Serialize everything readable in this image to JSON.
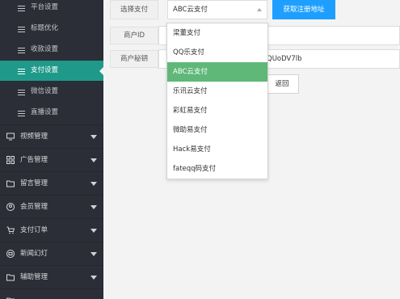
{
  "sidebar": {
    "sub_items": [
      {
        "label": "平台设置",
        "active": false
      },
      {
        "label": "标题优化",
        "active": false
      },
      {
        "label": "收款设置",
        "active": false
      },
      {
        "label": "支付设置",
        "active": true
      },
      {
        "label": "微信设置",
        "active": false
      },
      {
        "label": "直播设置",
        "active": false
      }
    ],
    "groups": [
      {
        "label": "视频管理",
        "icon": "monitor-icon"
      },
      {
        "label": "广告管理",
        "icon": "grid-icon"
      },
      {
        "label": "留言管理",
        "icon": "folder-icon"
      },
      {
        "label": "会员管理",
        "icon": "user-circle-icon"
      },
      {
        "label": "支付订单",
        "icon": "cart-icon"
      },
      {
        "label": "新闻幻灯",
        "icon": "slides-icon"
      },
      {
        "label": "辅助管理",
        "icon": "folder-icon"
      }
    ]
  },
  "form": {
    "payment_label": "选择支付",
    "payment_selected": "ABC云支付",
    "get_url_button": "获取注册地址",
    "merchant_id_label": "商户ID",
    "merchant_secret_label": "商户秘钥",
    "merchant_secret_value": "QUoDV7lb",
    "back_button": "返回"
  },
  "dropdown": {
    "options": [
      {
        "label": "梁董支付",
        "selected": false
      },
      {
        "label": "QQ乐支付",
        "selected": false
      },
      {
        "label": "ABC云支付",
        "selected": true
      },
      {
        "label": "乐讯云支付",
        "selected": false
      },
      {
        "label": "彩虹易支付",
        "selected": false
      },
      {
        "label": "微助易支付",
        "selected": false
      },
      {
        "label": "Hack易支付",
        "selected": false
      },
      {
        "label": "fateqq码支付",
        "selected": false
      }
    ]
  },
  "colors": {
    "sidebar_bg": "#2b2e36",
    "active_item": "#1f9a8a",
    "primary_button": "#1e9fff",
    "selected_option": "#5fb878"
  }
}
